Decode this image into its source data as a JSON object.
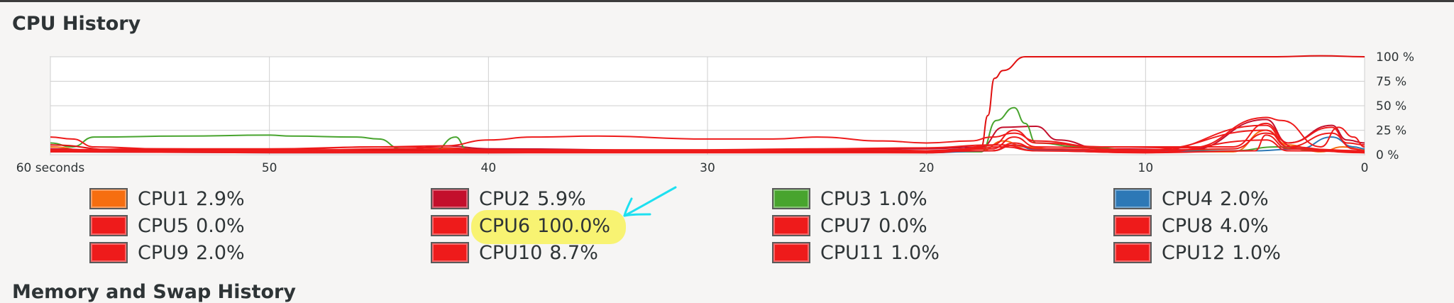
{
  "section": {
    "title": "CPU History",
    "next_title": "Memory and Swap History"
  },
  "chart_data": {
    "type": "line",
    "x_axis": {
      "ticks": [
        60,
        50,
        40,
        30,
        20,
        10,
        0
      ],
      "tick_labels": [
        "60 seconds",
        "50",
        "40",
        "30",
        "20",
        "10",
        "0"
      ],
      "range": [
        60,
        0
      ]
    },
    "y_axis": {
      "ticks": [
        100,
        75,
        50,
        25,
        0
      ],
      "tick_labels": [
        "100 %",
        "75 %",
        "50 %",
        "25 %",
        "0 %"
      ],
      "range": [
        0,
        100
      ]
    },
    "grid": true,
    "series": [
      {
        "name": "CPU1",
        "color": "#f66e10",
        "values": [
          [
            60,
            8
          ],
          [
            58,
            3
          ],
          [
            54,
            3
          ],
          [
            50,
            4
          ],
          [
            46,
            3
          ],
          [
            42,
            6
          ],
          [
            40,
            3
          ],
          [
            30,
            3
          ],
          [
            20,
            3
          ],
          [
            17.5,
            4
          ],
          [
            16.5,
            14
          ],
          [
            15.5,
            8
          ],
          [
            14,
            5
          ],
          [
            10,
            3
          ],
          [
            6,
            3
          ],
          [
            4.5,
            25
          ],
          [
            3.5,
            10
          ],
          [
            2,
            3
          ],
          [
            1,
            8
          ],
          [
            0,
            5
          ]
        ]
      },
      {
        "name": "CPU2",
        "color": "#c30f2c",
        "values": [
          [
            60,
            6
          ],
          [
            57,
            4
          ],
          [
            50,
            4
          ],
          [
            44,
            5
          ],
          [
            42,
            9
          ],
          [
            40,
            6
          ],
          [
            30,
            4
          ],
          [
            22,
            6
          ],
          [
            20,
            6
          ],
          [
            17.5,
            8
          ],
          [
            16.5,
            28
          ],
          [
            15,
            29
          ],
          [
            14,
            15
          ],
          [
            12,
            6
          ],
          [
            8,
            5
          ],
          [
            4.5,
            36
          ],
          [
            3.5,
            12
          ],
          [
            1.5,
            30
          ],
          [
            0.8,
            15
          ],
          [
            0,
            12
          ]
        ]
      },
      {
        "name": "CPU3",
        "color": "#48a42e",
        "values": [
          [
            60,
            12
          ],
          [
            59,
            8
          ],
          [
            58,
            18
          ],
          [
            54,
            19
          ],
          [
            50,
            20
          ],
          [
            49,
            19
          ],
          [
            46,
            18
          ],
          [
            45,
            16
          ],
          [
            44,
            6
          ],
          [
            42.5,
            4
          ],
          [
            41.5,
            18
          ],
          [
            41,
            6
          ],
          [
            40,
            3
          ],
          [
            30,
            3
          ],
          [
            20,
            3
          ],
          [
            17.5,
            3
          ],
          [
            16.8,
            35
          ],
          [
            16,
            48
          ],
          [
            15.5,
            32
          ],
          [
            15,
            12
          ],
          [
            13,
            8
          ],
          [
            10,
            4
          ],
          [
            6,
            4
          ],
          [
            4,
            8
          ],
          [
            2,
            4
          ],
          [
            0,
            3
          ]
        ]
      },
      {
        "name": "CPU4",
        "color": "#2d78b6",
        "values": [
          [
            60,
            3
          ],
          [
            50,
            2
          ],
          [
            40,
            2
          ],
          [
            30,
            4
          ],
          [
            22,
            3
          ],
          [
            20,
            2
          ],
          [
            17,
            4
          ],
          [
            16,
            10
          ],
          [
            15,
            5
          ],
          [
            10,
            3
          ],
          [
            5,
            4
          ],
          [
            3,
            6
          ],
          [
            1.5,
            18
          ],
          [
            0.5,
            8
          ],
          [
            0,
            6
          ]
        ]
      },
      {
        "name": "CPU5",
        "color": "#ee1b1b",
        "values": [
          [
            60,
            5
          ],
          [
            50,
            3
          ],
          [
            42,
            4
          ],
          [
            40,
            3
          ],
          [
            30,
            3
          ],
          [
            20,
            3
          ],
          [
            17,
            4
          ],
          [
            16,
            12
          ],
          [
            15,
            6
          ],
          [
            10,
            3
          ],
          [
            4.5,
            30
          ],
          [
            3.5,
            8
          ],
          [
            1,
            4
          ],
          [
            0,
            2
          ]
        ]
      },
      {
        "name": "CPU6",
        "color": "#e01010",
        "values": [
          [
            60,
            10
          ],
          [
            57,
            5
          ],
          [
            50,
            5
          ],
          [
            40,
            5
          ],
          [
            36,
            4
          ],
          [
            30,
            4
          ],
          [
            20,
            4
          ],
          [
            18,
            6
          ],
          [
            17.5,
            8
          ],
          [
            17.2,
            40
          ],
          [
            16.9,
            78
          ],
          [
            16.5,
            86
          ],
          [
            15.5,
            100
          ],
          [
            12,
            100
          ],
          [
            8,
            100
          ],
          [
            4,
            100
          ],
          [
            2,
            101
          ],
          [
            0,
            100
          ]
        ]
      },
      {
        "name": "CPU7",
        "color": "#ee1b1b",
        "values": [
          [
            60,
            3
          ],
          [
            50,
            2
          ],
          [
            40,
            2
          ],
          [
            30,
            3
          ],
          [
            20,
            2
          ],
          [
            16.5,
            10
          ],
          [
            15,
            4
          ],
          [
            10,
            2
          ],
          [
            5,
            4
          ],
          [
            4.5,
            20
          ],
          [
            3.5,
            6
          ],
          [
            0,
            2
          ]
        ]
      },
      {
        "name": "CPU8",
        "color": "#ee1b1b",
        "values": [
          [
            60,
            5
          ],
          [
            55,
            6
          ],
          [
            50,
            5
          ],
          [
            45,
            8
          ],
          [
            42,
            7
          ],
          [
            40,
            5
          ],
          [
            30,
            5
          ],
          [
            25,
            6
          ],
          [
            20,
            7
          ],
          [
            17,
            10
          ],
          [
            16,
            25
          ],
          [
            15,
            12
          ],
          [
            12,
            8
          ],
          [
            8,
            7
          ],
          [
            4.5,
            38
          ],
          [
            3.8,
            35
          ],
          [
            2,
            8
          ],
          [
            1.2,
            28
          ],
          [
            0.5,
            18
          ],
          [
            0,
            8
          ]
        ]
      },
      {
        "name": "CPU9",
        "color": "#ee1b1b",
        "values": [
          [
            60,
            4
          ],
          [
            50,
            4
          ],
          [
            40,
            3
          ],
          [
            32,
            3
          ],
          [
            24,
            5
          ],
          [
            20,
            4
          ],
          [
            17,
            4
          ],
          [
            16,
            10
          ],
          [
            15,
            6
          ],
          [
            10,
            4
          ],
          [
            6,
            6
          ],
          [
            4.5,
            22
          ],
          [
            3,
            6
          ],
          [
            0,
            4
          ]
        ]
      },
      {
        "name": "CPU10",
        "color": "#ee1b1b",
        "values": [
          [
            60,
            18
          ],
          [
            59,
            16
          ],
          [
            58,
            8
          ],
          [
            55,
            6
          ],
          [
            50,
            6
          ],
          [
            45,
            8
          ],
          [
            42,
            9
          ],
          [
            40,
            15
          ],
          [
            38,
            18
          ],
          [
            35,
            19
          ],
          [
            30,
            16
          ],
          [
            27,
            16
          ],
          [
            25,
            18
          ],
          [
            22,
            14
          ],
          [
            20,
            12
          ],
          [
            18,
            14
          ],
          [
            17,
            18
          ],
          [
            16,
            22
          ],
          [
            15,
            14
          ],
          [
            12,
            8
          ],
          [
            10,
            8
          ],
          [
            6,
            8
          ],
          [
            4.5,
            32
          ],
          [
            3.5,
            12
          ],
          [
            1.5,
            28
          ],
          [
            0.8,
            12
          ],
          [
            0,
            10
          ]
        ]
      },
      {
        "name": "CPU11",
        "color": "#ee1b1b",
        "values": [
          [
            60,
            3
          ],
          [
            50,
            3
          ],
          [
            40,
            2
          ],
          [
            30,
            2
          ],
          [
            20,
            2
          ],
          [
            16.5,
            8
          ],
          [
            15,
            4
          ],
          [
            10,
            2
          ],
          [
            4.5,
            15
          ],
          [
            3.5,
            4
          ],
          [
            0,
            3
          ]
        ]
      },
      {
        "name": "CPU12",
        "color": "#ee1b1b",
        "values": [
          [
            60,
            4
          ],
          [
            50,
            4
          ],
          [
            44,
            6
          ],
          [
            40,
            4
          ],
          [
            30,
            4
          ],
          [
            22,
            5
          ],
          [
            20,
            4
          ],
          [
            17,
            6
          ],
          [
            16,
            18
          ],
          [
            15,
            8
          ],
          [
            10,
            5
          ],
          [
            4.5,
            25
          ],
          [
            3.5,
            8
          ],
          [
            1.5,
            22
          ],
          [
            0.5,
            6
          ],
          [
            0,
            4
          ]
        ]
      }
    ]
  },
  "legend": {
    "items": [
      {
        "label": "CPU1",
        "value": "2.9%",
        "color": "#f66e10"
      },
      {
        "label": "CPU2",
        "value": "5.9%",
        "color": "#c30f2c"
      },
      {
        "label": "CPU3",
        "value": "1.0%",
        "color": "#48a42e"
      },
      {
        "label": "CPU4",
        "value": "2.0%",
        "color": "#2d78b6"
      },
      {
        "label": "CPU5",
        "value": "0.0%",
        "color": "#ee1b1b"
      },
      {
        "label": "CPU6",
        "value": "100.0%",
        "color": "#ee1b1b"
      },
      {
        "label": "CPU7",
        "value": "0.0%",
        "color": "#ee1b1b"
      },
      {
        "label": "CPU8",
        "value": "4.0%",
        "color": "#ee1b1b"
      },
      {
        "label": "CPU9",
        "value": "2.0%",
        "color": "#ee1b1b"
      },
      {
        "label": "CPU10",
        "value": "8.7%",
        "color": "#ee1b1b"
      },
      {
        "label": "CPU11",
        "value": "1.0%",
        "color": "#ee1b1b"
      },
      {
        "label": "CPU12",
        "value": "1.0%",
        "color": "#ee1b1b"
      }
    ]
  },
  "annotation": {
    "highlight_color": "#f8f26a",
    "arrow_color": "#1ee0f0"
  }
}
